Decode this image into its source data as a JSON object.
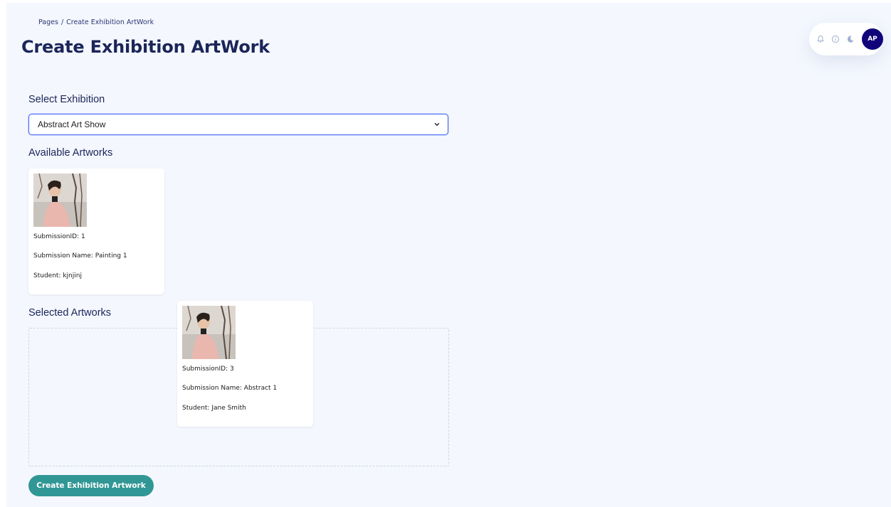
{
  "breadcrumb": {
    "root": "Pages",
    "separator": "/",
    "current": "Create Exhibition ArtWork"
  },
  "page_title": "Create Exhibition ArtWork",
  "topbar": {
    "icons": [
      "bell-icon",
      "info-icon",
      "moon-icon"
    ],
    "avatar_initials": "AP",
    "avatar_color": "#11047a"
  },
  "form": {
    "select_label": "Select Exhibition",
    "selected_exhibition": "Abstract Art Show",
    "available_label": "Available Artworks",
    "selected_label": "Selected Artworks",
    "submit_label": "Create Exhibition Artwork"
  },
  "available_artworks": [
    {
      "id_text": "SubmissionID: 1",
      "name_text": "Submission Name: Painting 1",
      "student_text": "Student: kjnjinj"
    }
  ],
  "dragging_artwork": {
    "id_text": "SubmissionID: 3",
    "name_text": "Submission Name: Abstract 1",
    "student_text": "Student: Jane Smith"
  },
  "colors": {
    "accent": "#319795",
    "title": "#1b2559",
    "focus_border": "#4a6cf7",
    "background": "#f4f7fe"
  }
}
